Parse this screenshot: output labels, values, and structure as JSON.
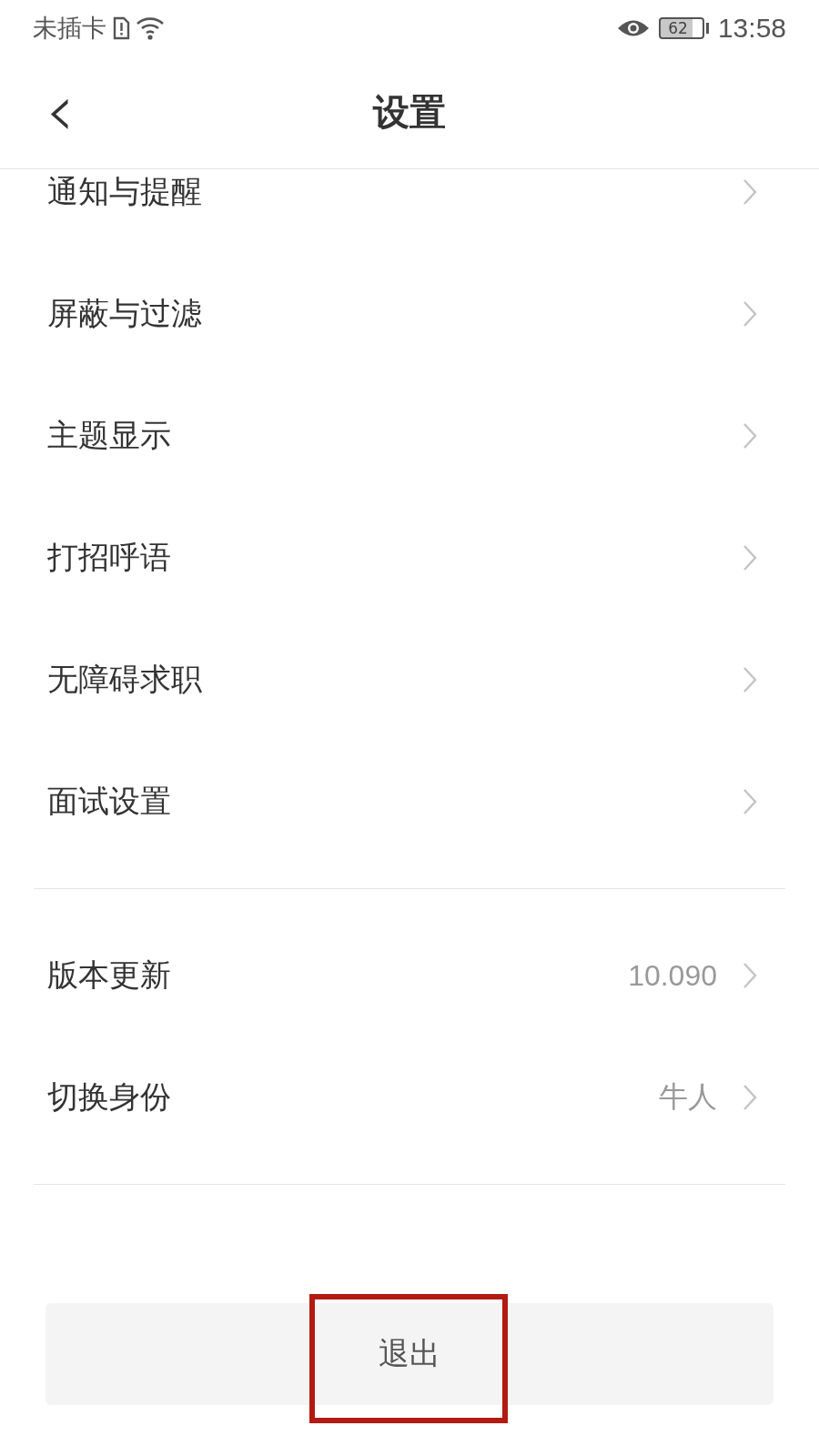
{
  "status_bar": {
    "carrier": "未插卡",
    "battery": "62",
    "time": "13:58"
  },
  "header": {
    "back": "‹",
    "title": "设置"
  },
  "groups": [
    {
      "items": [
        {
          "label": "通知与提醒"
        },
        {
          "label": "屏蔽与过滤"
        },
        {
          "label": "主题显示"
        },
        {
          "label": "打招呼语"
        },
        {
          "label": "无障碍求职"
        },
        {
          "label": "面试设置"
        }
      ]
    },
    {
      "items": [
        {
          "label": "版本更新",
          "value": "10.090"
        },
        {
          "label": "切换身份",
          "value": "牛人"
        }
      ]
    }
  ],
  "logout_button": {
    "label": "退出",
    "highlighted": true
  }
}
